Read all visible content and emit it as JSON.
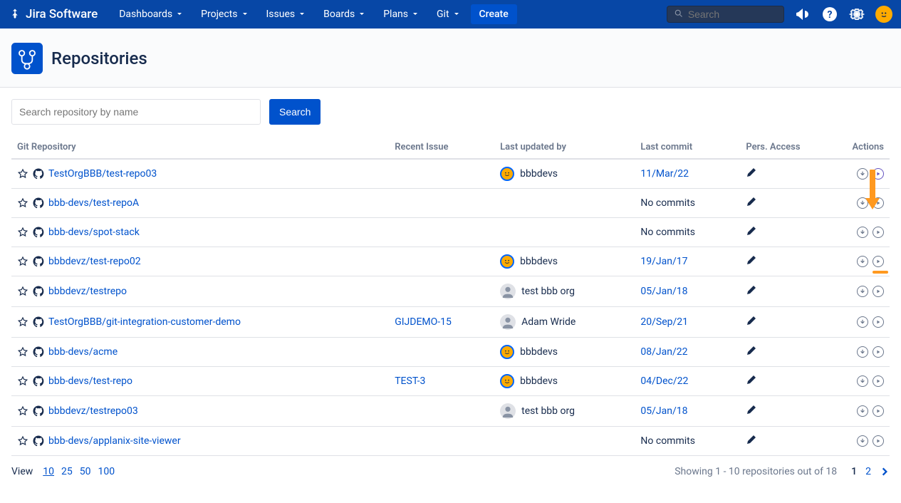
{
  "brand": "Jira Software",
  "nav": {
    "items": [
      "Dashboards",
      "Projects",
      "Issues",
      "Boards",
      "Plans",
      "Git"
    ],
    "create": "Create",
    "search_placeholder": "Search"
  },
  "page": {
    "title": "Repositories"
  },
  "search": {
    "placeholder": "Search repository by name",
    "button": "Search"
  },
  "table": {
    "headers": [
      "Git Repository",
      "Recent Issue",
      "Last updated by",
      "Last commit",
      "Pers. Access",
      "Actions"
    ],
    "rows": [
      {
        "repo": "TestOrgBBB/test-repo03",
        "issue": "",
        "user": "bbbdevs",
        "avatar": "orange",
        "commit": "11/Mar/22",
        "nocommit": false,
        "hlaction": true
      },
      {
        "repo": "bbb-devs/test-repoA",
        "issue": "",
        "user": "",
        "avatar": "",
        "commit": "No commits",
        "nocommit": true,
        "hlaction": false
      },
      {
        "repo": "bbb-devs/spot-stack",
        "issue": "",
        "user": "",
        "avatar": "",
        "commit": "No commits",
        "nocommit": true,
        "hlaction": false
      },
      {
        "repo": "bbbdevz/test-repo02",
        "issue": "",
        "user": "bbbdevs",
        "avatar": "orange",
        "commit": "19/Jan/17",
        "nocommit": false,
        "hlaction": false
      },
      {
        "repo": "bbbdevz/testrepo",
        "issue": "",
        "user": "test bbb org",
        "avatar": "gray",
        "commit": "05/Jan/18",
        "nocommit": false,
        "hlaction": false
      },
      {
        "repo": "TestOrgBBB/git-integration-customer-demo",
        "issue": "GIJDEMO-15",
        "user": "Adam Wride",
        "avatar": "gray",
        "commit": "20/Sep/21",
        "nocommit": false,
        "hlaction": false
      },
      {
        "repo": "bbb-devs/acme",
        "issue": "",
        "user": "bbbdevs",
        "avatar": "orange",
        "commit": "08/Jan/22",
        "nocommit": false,
        "hlaction": false
      },
      {
        "repo": "bbb-devs/test-repo",
        "issue": "TEST-3",
        "user": "bbbdevs",
        "avatar": "orange",
        "commit": "04/Dec/22",
        "nocommit": false,
        "hlaction": false
      },
      {
        "repo": "bbbdevz/testrepo03",
        "issue": "",
        "user": "test bbb org",
        "avatar": "gray",
        "commit": "05/Jan/18",
        "nocommit": false,
        "hlaction": false
      },
      {
        "repo": "bbb-devs/applanix-site-viewer",
        "issue": "",
        "user": "",
        "avatar": "",
        "commit": "No commits",
        "nocommit": true,
        "hlaction": false
      }
    ]
  },
  "footer": {
    "view_label": "View",
    "view_opts": [
      "10",
      "25",
      "50",
      "100"
    ],
    "view_active": "10",
    "showing": "Showing 1 - 10 repositories out of 18",
    "pages": [
      "1",
      "2"
    ],
    "current_page": "1"
  }
}
